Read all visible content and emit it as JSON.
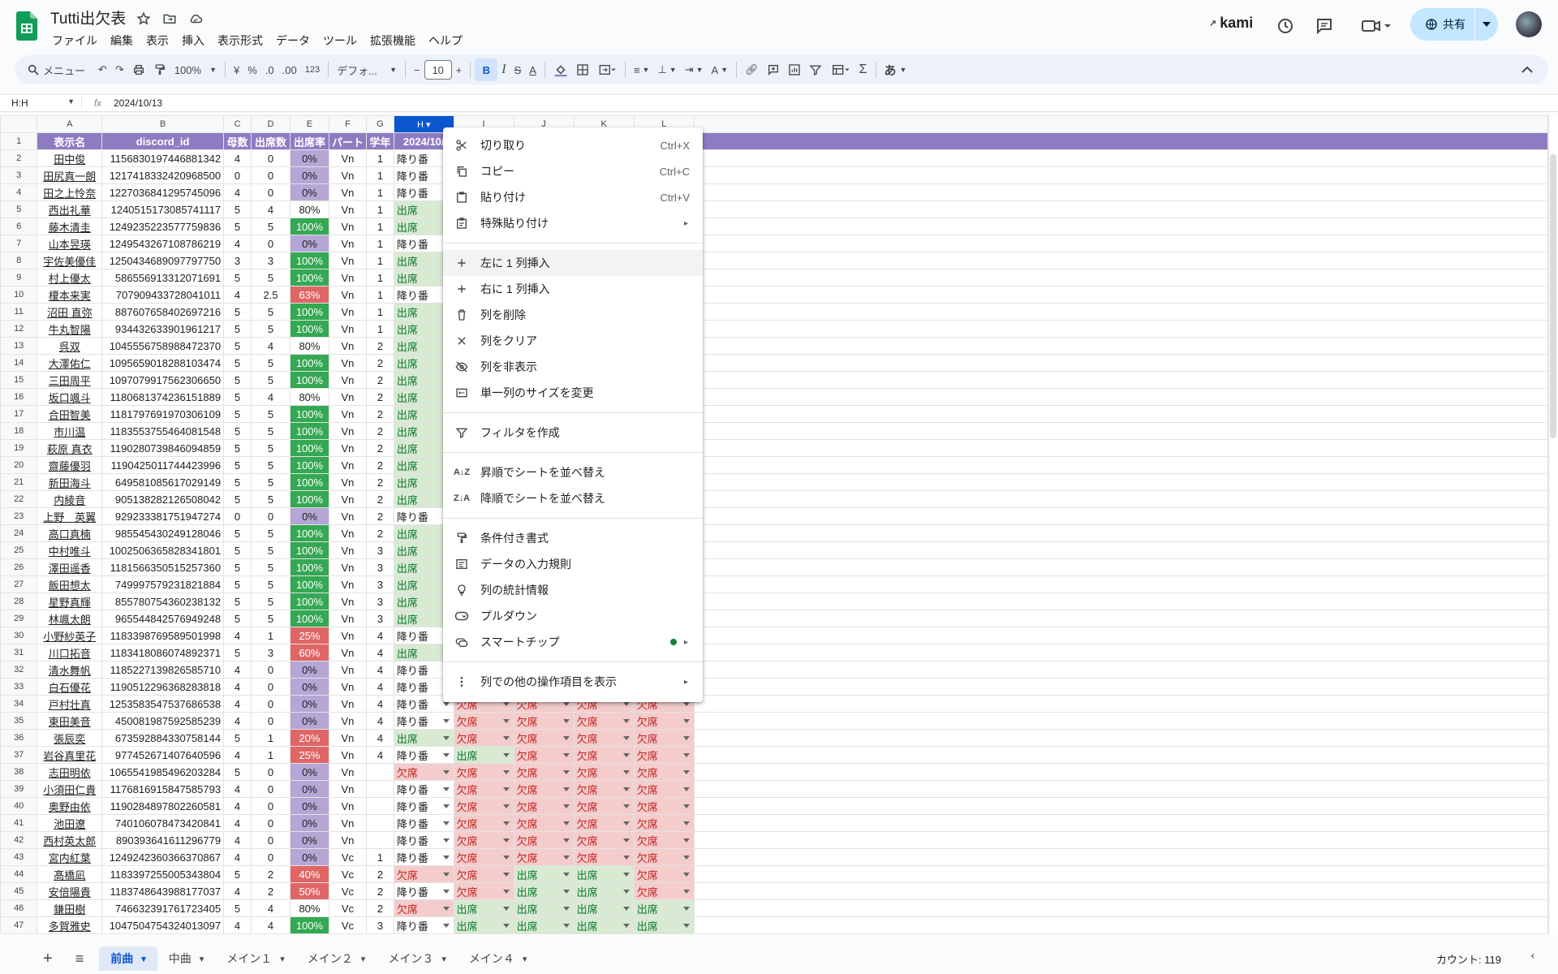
{
  "doc": {
    "title": "Tutti出欠表"
  },
  "menu": [
    "ファイル",
    "編集",
    "表示",
    "挿入",
    "表示形式",
    "データ",
    "ツール",
    "拡張機能",
    "ヘルプ"
  ],
  "header": {
    "account": "kami",
    "share_label": "共有"
  },
  "toolbar": {
    "search": "メニュー",
    "zoom": "100%",
    "currency": "¥",
    "percent": "%",
    "dec_dec": ".0",
    "dec_inc": ".00",
    "numfmt": "123",
    "font": "デフォ...",
    "font_size": "10",
    "bold": "B",
    "italic": "I",
    "strike": "S",
    "textcolor": "A",
    "ime": "あ"
  },
  "formula": {
    "cell": "H:H",
    "fx": "fx",
    "value": "2024/10/13"
  },
  "columns": [
    "A",
    "B",
    "C",
    "D",
    "E",
    "F",
    "G",
    "H",
    "I",
    "J",
    "K",
    "L"
  ],
  "col_headers": [
    "表示名",
    "discord_id",
    "母数",
    "出席数",
    "出席率",
    "パート",
    "学年",
    "2024/10/"
  ],
  "rows": [
    [
      "田中俊",
      "1156830197446881342",
      "4",
      "0",
      "0%",
      "Vn",
      "1",
      "降り番",
      "",
      "",
      "",
      ""
    ],
    [
      "田尻真一朗",
      "1217418332420968500",
      "0",
      "0",
      "0%",
      "Vn",
      "1",
      "降り番",
      "",
      "",
      "",
      ""
    ],
    [
      "田之上怜奈",
      "1227036841295745096",
      "4",
      "0",
      "0%",
      "Vn",
      "1",
      "降り番",
      "",
      "",
      "",
      ""
    ],
    [
      "西出礼華",
      "1240515173085741117",
      "5",
      "4",
      "80%",
      "Vn",
      "1",
      "出席",
      "",
      "",
      "",
      ""
    ],
    [
      "藤木清圭",
      "1249235223577759836",
      "5",
      "5",
      "100%",
      "Vn",
      "1",
      "出席",
      "",
      "",
      "",
      ""
    ],
    [
      "山本昱瑛",
      "1249543267108786219",
      "4",
      "0",
      "0%",
      "Vn",
      "1",
      "降り番",
      "",
      "",
      "",
      ""
    ],
    [
      "宇佐美優佳",
      "1250434689097797750",
      "3",
      "3",
      "100%",
      "Vn",
      "1",
      "出席",
      "",
      "",
      "",
      ""
    ],
    [
      "村上優太",
      "586556913312071691",
      "5",
      "5",
      "100%",
      "Vn",
      "1",
      "出席",
      "",
      "",
      "",
      ""
    ],
    [
      "榎本来実",
      "707909433728041011",
      "4",
      "2.5",
      "63%",
      "Vn",
      "1",
      "降り番",
      "",
      "",
      "",
      ""
    ],
    [
      "沼田 直弥",
      "887607658402697216",
      "5",
      "5",
      "100%",
      "Vn",
      "1",
      "出席",
      "",
      "",
      "",
      ""
    ],
    [
      "牛丸智陽",
      "934432633901961217",
      "5",
      "5",
      "100%",
      "Vn",
      "1",
      "出席",
      "",
      "",
      "",
      ""
    ],
    [
      "呉双",
      "1045556758988472370",
      "5",
      "4",
      "80%",
      "Vn",
      "2",
      "出席",
      "",
      "",
      "",
      ""
    ],
    [
      "大澤佑仁",
      "1095659018288103474",
      "5",
      "5",
      "100%",
      "Vn",
      "2",
      "出席",
      "",
      "",
      "",
      ""
    ],
    [
      "三田周平",
      "1097079917562306650",
      "5",
      "5",
      "100%",
      "Vn",
      "2",
      "出席",
      "",
      "",
      "",
      ""
    ],
    [
      "坂口颯斗",
      "1180681374236151889",
      "5",
      "4",
      "80%",
      "Vn",
      "2",
      "出席",
      "",
      "",
      "",
      ""
    ],
    [
      "合田智美",
      "1181797691970306109",
      "5",
      "5",
      "100%",
      "Vn",
      "2",
      "出席",
      "",
      "",
      "",
      ""
    ],
    [
      "市川温",
      "1183553755464081548",
      "5",
      "5",
      "100%",
      "Vn",
      "2",
      "出席",
      "",
      "",
      "",
      ""
    ],
    [
      "萩原 真衣",
      "1190280739846094859",
      "5",
      "5",
      "100%",
      "Vn",
      "2",
      "出席",
      "",
      "",
      "",
      ""
    ],
    [
      "齋藤優羽",
      "1190425011744423996",
      "5",
      "5",
      "100%",
      "Vn",
      "2",
      "出席",
      "",
      "",
      "",
      ""
    ],
    [
      "新田海斗",
      "649581085617029149",
      "5",
      "5",
      "100%",
      "Vn",
      "2",
      "出席",
      "",
      "",
      "",
      ""
    ],
    [
      "内綾音",
      "905138282126508042",
      "5",
      "5",
      "100%",
      "Vn",
      "2",
      "出席",
      "",
      "",
      "",
      ""
    ],
    [
      "上野　英翼",
      "929233381751947274",
      "0",
      "0",
      "0%",
      "Vn",
      "2",
      "降り番",
      "",
      "",
      "",
      ""
    ],
    [
      "高口真楠",
      "985545430249128046",
      "5",
      "5",
      "100%",
      "Vn",
      "2",
      "出席",
      "",
      "",
      "",
      ""
    ],
    [
      "中村唯斗",
      "1002506365828341801",
      "5",
      "5",
      "100%",
      "Vn",
      "3",
      "出席",
      "",
      "",
      "",
      ""
    ],
    [
      "澤田遥香",
      "1181566350515257360",
      "5",
      "5",
      "100%",
      "Vn",
      "3",
      "出席",
      "",
      "",
      "",
      ""
    ],
    [
      "飯田想太",
      "749997579231821884",
      "5",
      "5",
      "100%",
      "Vn",
      "3",
      "出席",
      "",
      "",
      "",
      ""
    ],
    [
      "星野真輝",
      "855780754360238132",
      "5",
      "5",
      "100%",
      "Vn",
      "3",
      "出席",
      "",
      "",
      "",
      ""
    ],
    [
      "林颯太朗",
      "965544842576949248",
      "5",
      "5",
      "100%",
      "Vn",
      "3",
      "出席",
      "",
      "",
      "",
      ""
    ],
    [
      "小野紗英子",
      "1183398769589501998",
      "4",
      "1",
      "25%",
      "Vn",
      "4",
      "降り番",
      "",
      "",
      "",
      ""
    ],
    [
      "川口拓音",
      "1183418086074892371",
      "5",
      "3",
      "60%",
      "Vn",
      "4",
      "出席",
      "",
      "",
      "",
      ""
    ],
    [
      "清水舞帆",
      "1185227139826585710",
      "4",
      "0",
      "0%",
      "Vn",
      "4",
      "降り番",
      "",
      "",
      "",
      ""
    ],
    [
      "白石優花",
      "1190512296368283818",
      "4",
      "0",
      "0%",
      "Vn",
      "4",
      "降り番",
      "",
      "",
      "",
      ""
    ],
    [
      "戸村壮真",
      "1253583547537686538",
      "4",
      "0",
      "0%",
      "Vn",
      "4",
      "降り番",
      "欠席",
      "欠席",
      "欠席",
      "欠席"
    ],
    [
      "東田美音",
      "450081987592585239",
      "4",
      "0",
      "0%",
      "Vn",
      "4",
      "降り番",
      "欠席",
      "欠席",
      "欠席",
      "欠席"
    ],
    [
      "張辰奕",
      "673592884330758144",
      "5",
      "1",
      "20%",
      "Vn",
      "4",
      "出席",
      "欠席",
      "欠席",
      "欠席",
      "欠席"
    ],
    [
      "岩谷真里花",
      "977452671407640596",
      "4",
      "1",
      "25%",
      "Vn",
      "4",
      "降り番",
      "出席",
      "欠席",
      "欠席",
      "欠席"
    ],
    [
      "志田明依",
      "1065541985496203284",
      "5",
      "0",
      "0%",
      "Vn",
      "",
      "欠席",
      "欠席",
      "欠席",
      "欠席",
      "欠席"
    ],
    [
      "小須田仁貴",
      "1176816915847585793",
      "4",
      "0",
      "0%",
      "Vn",
      "",
      "降り番",
      "欠席",
      "欠席",
      "欠席",
      "欠席"
    ],
    [
      "奥野由依",
      "1190284897802260581",
      "4",
      "0",
      "0%",
      "Vn",
      "",
      "降り番",
      "欠席",
      "欠席",
      "欠席",
      "欠席"
    ],
    [
      "池田遼",
      "740106078473420841",
      "4",
      "0",
      "0%",
      "Vn",
      "",
      "降り番",
      "欠席",
      "欠席",
      "欠席",
      "欠席"
    ],
    [
      "西村英太郎",
      "890393641611296779",
      "4",
      "0",
      "0%",
      "Vn",
      "",
      "降り番",
      "欠席",
      "欠席",
      "欠席",
      "欠席"
    ],
    [
      "宮内紅葉",
      "1249242360366370867",
      "4",
      "0",
      "0%",
      "Vc",
      "1",
      "降り番",
      "欠席",
      "欠席",
      "欠席",
      "欠席"
    ],
    [
      "髙橋凪",
      "1183397255005343804",
      "5",
      "2",
      "40%",
      "Vc",
      "2",
      "欠席",
      "欠席",
      "出席",
      "出席",
      "欠席"
    ],
    [
      "安倍陽貴",
      "1183748643988177037",
      "4",
      "2",
      "50%",
      "Vc",
      "2",
      "降り番",
      "欠席",
      "出席",
      "出席",
      "欠席"
    ],
    [
      "鎌田樹",
      "746632391761723405",
      "5",
      "4",
      "80%",
      "Vc",
      "2",
      "欠席",
      "出席",
      "出席",
      "出席",
      "出席"
    ],
    [
      "多賀雅史",
      "1047504754324013097",
      "4",
      "4",
      "100%",
      "Vc",
      "3",
      "降り番",
      "出席",
      "出席",
      "出席",
      "出席"
    ]
  ],
  "context_menu": [
    {
      "icon": "scissors-icon",
      "label": "切り取り",
      "shortcut": "Ctrl+X"
    },
    {
      "icon": "copy-icon",
      "label": "コピー",
      "shortcut": "Ctrl+C"
    },
    {
      "icon": "paste-icon",
      "label": "貼り付け",
      "shortcut": "Ctrl+V"
    },
    {
      "icon": "paste-special-icon",
      "label": "特殊貼り付け",
      "submenu": true
    },
    {
      "sep": true
    },
    {
      "icon": "plus-icon",
      "label": "左に 1 列挿入",
      "highlight": true
    },
    {
      "icon": "plus-icon",
      "label": "右に 1 列挿入"
    },
    {
      "icon": "trash-icon",
      "label": "列を削除"
    },
    {
      "icon": "close-icon",
      "label": "列をクリア"
    },
    {
      "icon": "eye-off-icon",
      "label": "列を非表示"
    },
    {
      "icon": "resize-icon",
      "label": "単一列のサイズを変更"
    },
    {
      "sep": true
    },
    {
      "icon": "filter-icon",
      "label": "フィルタを作成"
    },
    {
      "sep": true
    },
    {
      "icon": "sort-asc-icon",
      "label": "昇順でシートを並べ替え"
    },
    {
      "icon": "sort-desc-icon",
      "label": "降順でシートを並べ替え"
    },
    {
      "sep": true
    },
    {
      "icon": "paint-roller-icon",
      "label": "条件付き書式"
    },
    {
      "icon": "data-validation-icon",
      "label": "データの入力規則"
    },
    {
      "icon": "lightbulb-icon",
      "label": "列の統計情報"
    },
    {
      "icon": "dropdown-icon",
      "label": "プルダウン"
    },
    {
      "icon": "smart-chip-icon",
      "label": "スマートチップ",
      "submenu": true,
      "dot": true
    },
    {
      "sep": true
    },
    {
      "icon": "more-vert-icon",
      "label": "列での他の操作項目を表示",
      "submenu": true
    }
  ],
  "sheets": [
    "前曲",
    "中曲",
    "メイン１",
    "メイン２",
    "メイン３",
    "メイン４"
  ],
  "active_sheet": 0,
  "status": {
    "count": "カウント: 119"
  },
  "colors": {
    "accent": "#0b57d0",
    "header_purple": "#8e7cc3",
    "rate_purple": "#b4a7d6",
    "rate_green": "#34a853",
    "rate_red": "#e06666",
    "present": "#d9ead3",
    "absent": "#f4cccc"
  }
}
